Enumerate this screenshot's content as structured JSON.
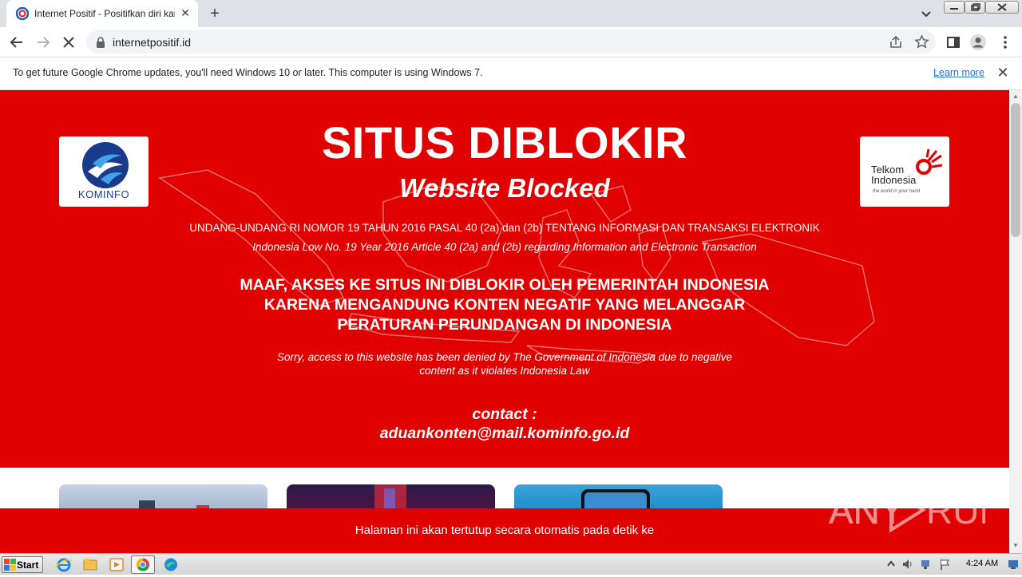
{
  "browser": {
    "tab": {
      "title": "Internet Positif - Positifkan diri kamu",
      "close_glyph": "✕"
    },
    "new_tab_glyph": "+",
    "url": "internetpositif.id"
  },
  "infobar": {
    "message": "To get future Google Chrome updates, you'll need Windows 10 or later. This computer is using Windows 7.",
    "link": "Learn more",
    "close_glyph": "✕"
  },
  "hero": {
    "kominfo_logo_text": "KOMINFO",
    "telkom_logo_text": "Telkom Indonesia",
    "telkom_tagline": "the world in your hand",
    "title": "SITUS DIBLOKIR",
    "subtitle": "Website Blocked",
    "law_id": "UNDANG-UNDANG RI NOMOR 19 TAHUN 2016 PASAL 40 (2a) dan (2b) TENTANG INFORMASI DAN TRANSAKSI ELEKTRONIK",
    "law_en": "Indonesia Low No. 19 Year 2016 Article 40 (2a) and (2b) regarding Information and Electronic Transaction",
    "warning_lines": [
      "MAAF, AKSES KE SITUS INI DIBLOKIR OLEH PEMERINTAH INDONESIA",
      "KARENA MENGANDUNG KONTEN NEGATIF YANG MELANGGAR",
      "PERATURAN  PERUNDANGAN DI INDONESIA"
    ],
    "sorry_lines": [
      "Sorry, access to this website has been denied by The Government of Indonesia due to negative",
      "content as it violates Indonesia Law"
    ],
    "contact_label": "contact :",
    "contact_email": "aduankonten@mail.kominfo.go.id"
  },
  "autoclose": {
    "text": "Halaman ini akan tertutup secara otomatis pada detik ke"
  },
  "watermark": {
    "text": "ANY RUN"
  },
  "taskbar": {
    "start_label": "Start",
    "apps": [
      "internet-explorer-icon",
      "explorer-folder-icon",
      "media-player-icon",
      "chrome-icon",
      "edge-icon"
    ],
    "clock": "4:24 AM"
  },
  "colors": {
    "hero_red": "#e00000",
    "chrome_blue": "#1a73e8",
    "tab_strip": "#dee1e6"
  }
}
